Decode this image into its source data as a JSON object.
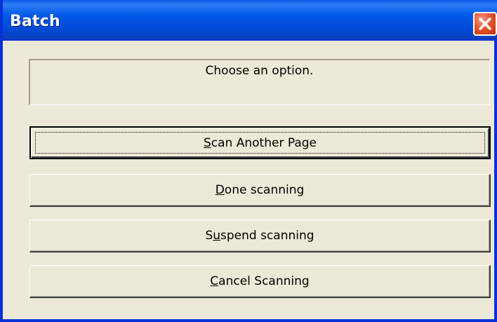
{
  "window": {
    "title": "Batch"
  },
  "message": "Choose an option.",
  "buttons": [
    {
      "pre": "",
      "accel": "S",
      "post": "can Another Page"
    },
    {
      "pre": "",
      "accel": "D",
      "post": "one scanning"
    },
    {
      "pre": "S",
      "accel": "u",
      "post": "spend scanning"
    },
    {
      "pre": "",
      "accel": "C",
      "post": "ancel Scanning"
    }
  ],
  "icons": {
    "close": "close-icon"
  },
  "colors": {
    "titlebar": "#0058e6",
    "close_button": "#e3532d",
    "window_face": "#ece9d8"
  }
}
